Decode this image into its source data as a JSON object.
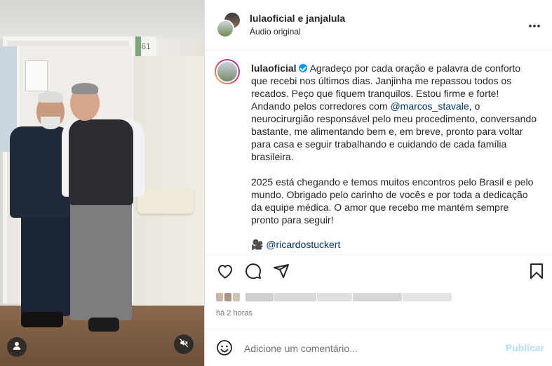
{
  "media": {
    "room_number": "61",
    "user_icon": "user-icon",
    "mute_icon": "speaker-muted-icon"
  },
  "header": {
    "names": "lulaoficial e janjalula",
    "subtitle": "Áudio original",
    "more_icon": "more-horizontal-icon"
  },
  "caption": {
    "username": "lulaoficial",
    "verified_icon": "verified-badge-icon",
    "text_part1": "Agradeço por cada oração e palavra de conforto que recebi nos últimos dias. Janjinha me repassou todos os recados. Peço que fiquem tranquilos. Estou firme e forte! Andando pelos corredores com ",
    "mention1": "@marcos_stavale",
    "text_part2": ", o neurocirurgião responsável pelo meu procedimento, conversando bastante, me alimentando bem e, em breve, pronto para voltar para casa e seguir trabalhando e cuidando de cada família brasileira.",
    "paragraph2": "2025 está chegando e temos muitos encontros pelo Brasil e pelo mundo. Obrigado pelo carinho de vocês e por toda a dedicação da equipe médica. O amor que recebo me mantém sempre pronto para seguir!",
    "credit_emoji": "🎥",
    "credit_mention": "@ricardostuckert"
  },
  "actions": {
    "like_icon": "heart-icon",
    "comment_icon": "comment-icon",
    "share_icon": "send-icon",
    "save_icon": "bookmark-icon"
  },
  "time": "há 2 horas",
  "comment": {
    "placeholder": "Adicione um comentário...",
    "publish_label": "Publicar",
    "emoji_icon": "smiley-icon"
  },
  "colors": {
    "accent": "#0095f6",
    "publish_disabled": "#b2dffc",
    "mention": "#00376b",
    "secondary_text": "#737373"
  }
}
